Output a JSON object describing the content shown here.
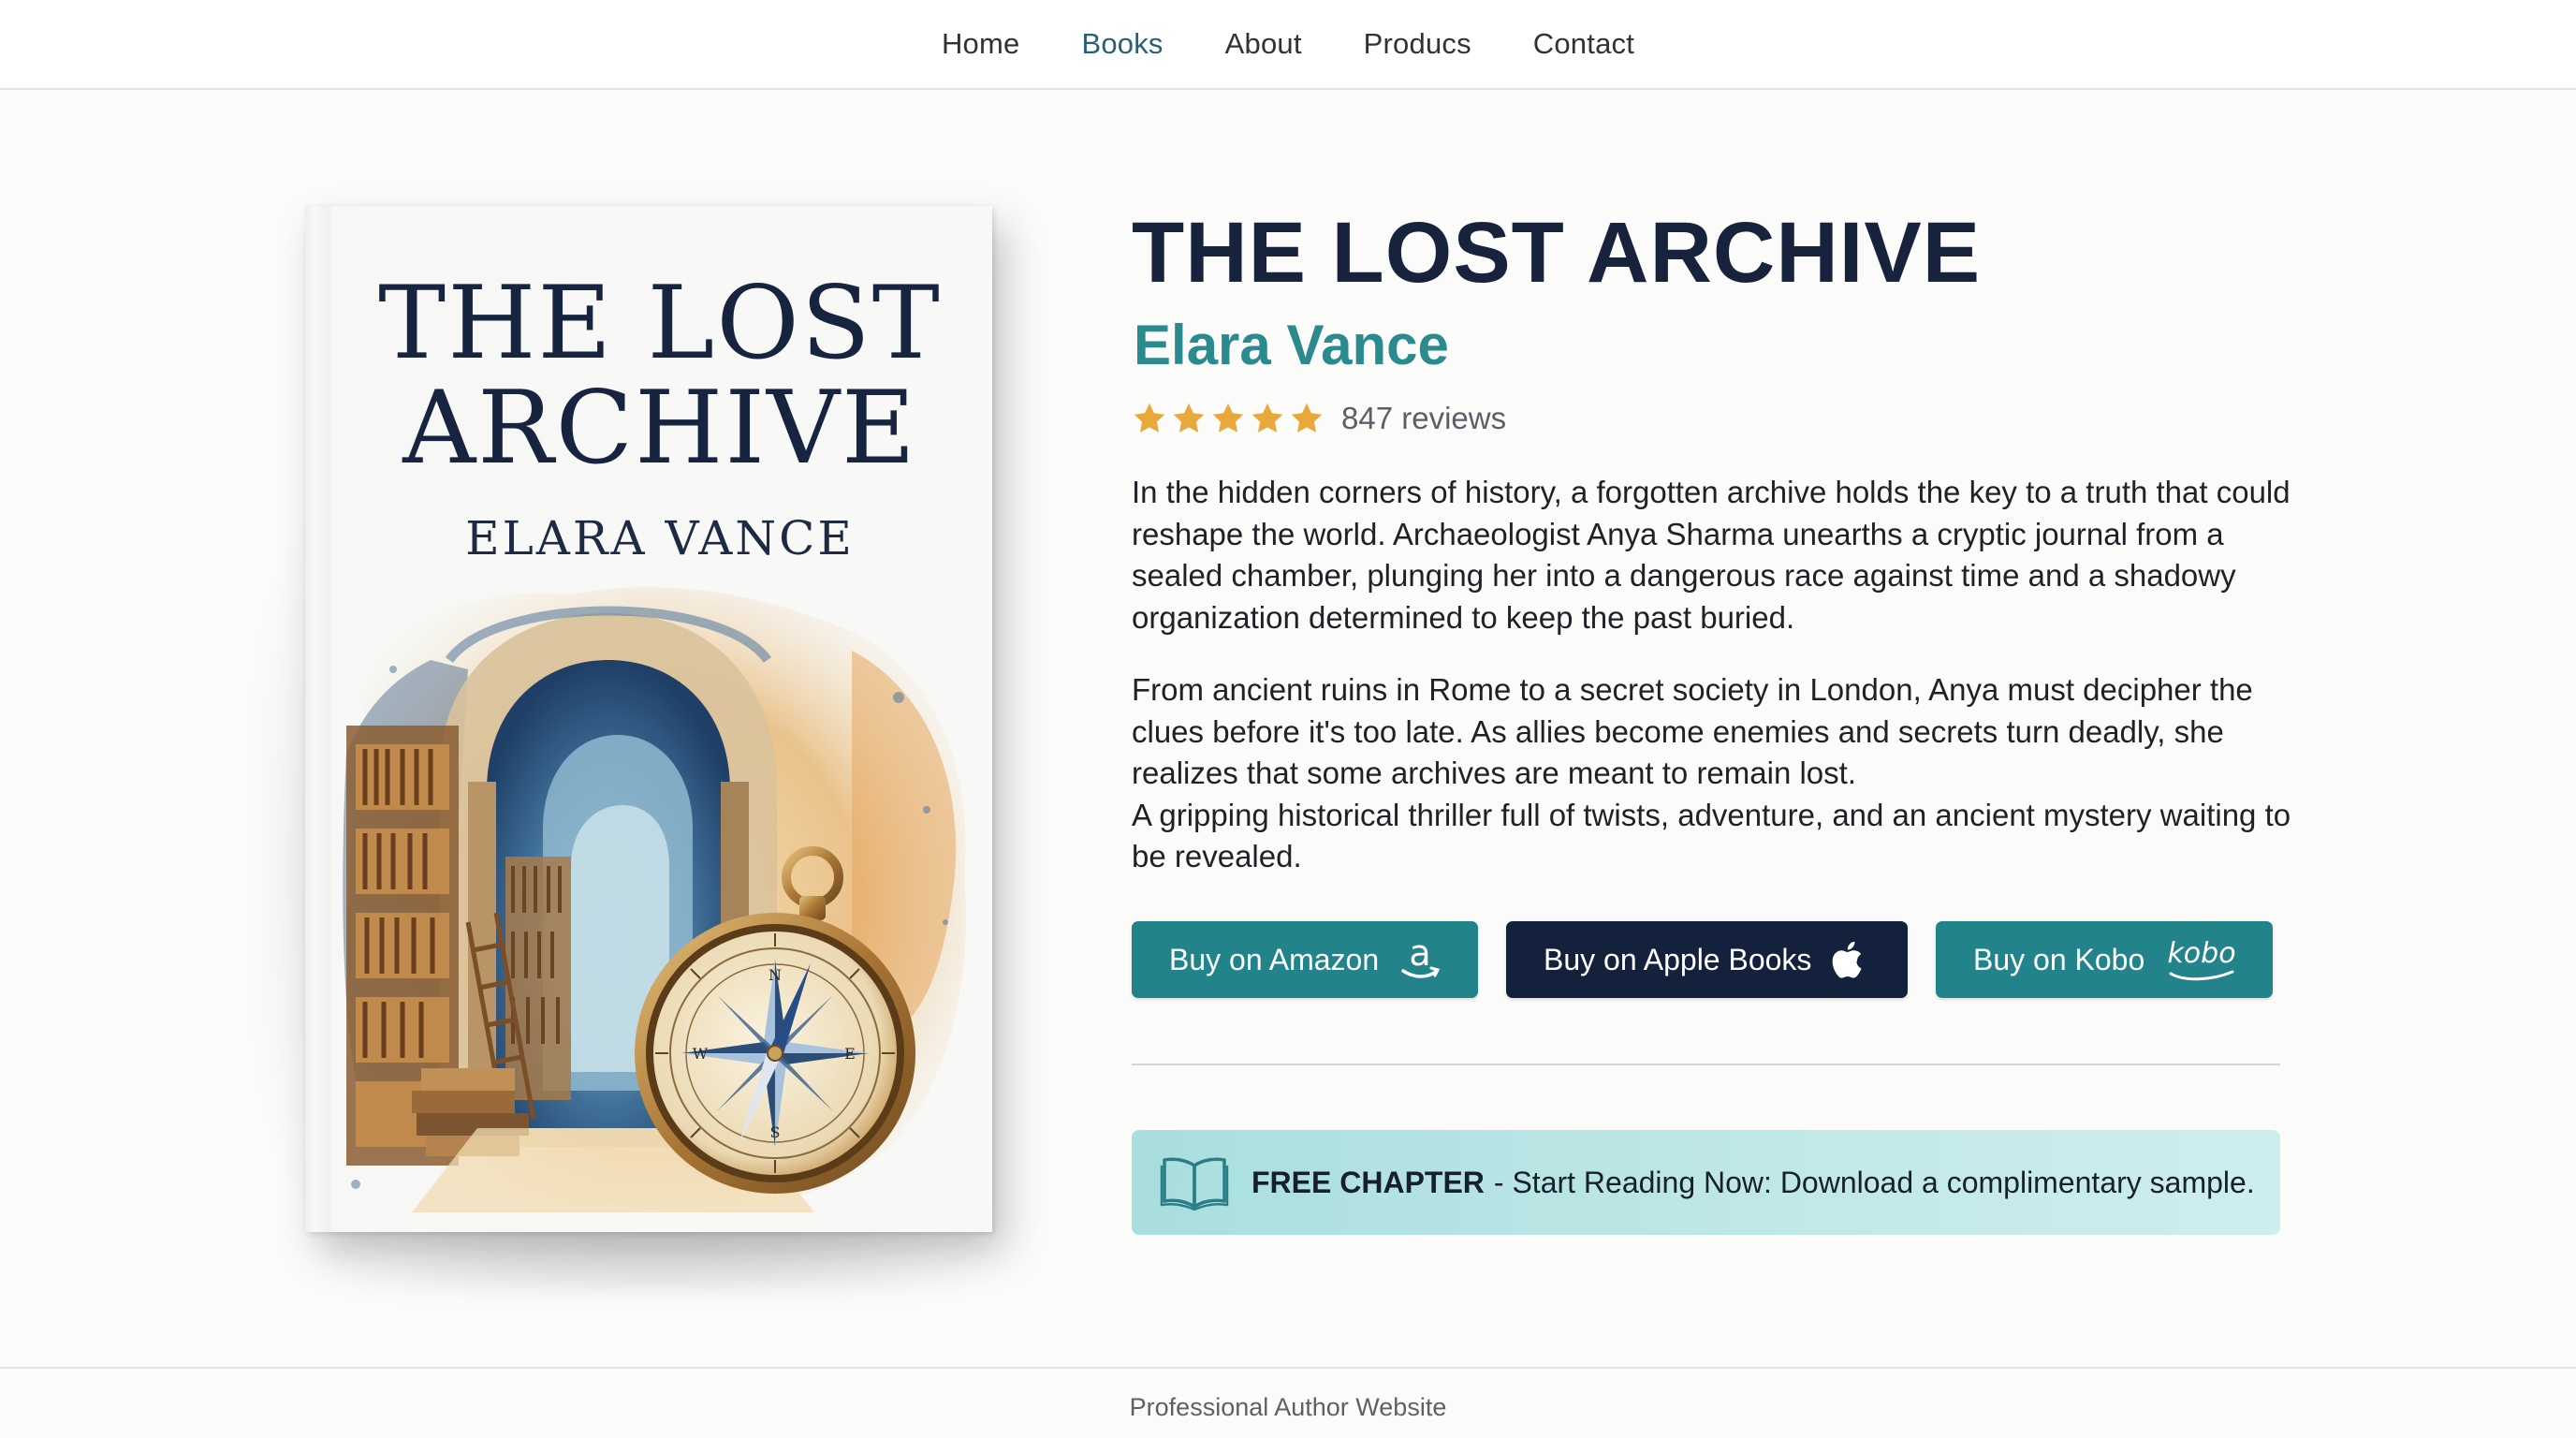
{
  "nav": {
    "items": [
      {
        "label": "Home",
        "active": false
      },
      {
        "label": "Books",
        "active": true
      },
      {
        "label": "About",
        "active": false
      },
      {
        "label": "Producs",
        "active": false
      },
      {
        "label": "Contact",
        "active": false
      }
    ]
  },
  "cover": {
    "title": "THE LOST\nARCHIVE",
    "author": "ELARA VANCE"
  },
  "book": {
    "title": "THE LOST ARCHIVE",
    "author": "Elara Vance",
    "rating": 5,
    "reviews": "847 reviews",
    "description": [
      "In the hidden corners of history, a forgotten archive holds the key to a truth that could reshape the world. Archaeologist Anya Sharma unearths a cryptic journal from a sealed chamber, plunging her into a dangerous race against time and a shadowy organization determined to keep the past buried.",
      "From ancient ruins in Rome to a secret society in London, Anya must decipher the clues before it's too late. As allies become enemies and secrets turn deadly, she realizes that some archives are meant to remain lost.",
      "A gripping historical thriller full of twists, adventure, and an ancient mystery waiting to be revealed."
    ]
  },
  "buttons": {
    "amazon": {
      "label": "Buy on Amazon",
      "icon": "amazon-icon"
    },
    "apple": {
      "label": "Buy on Apple Books",
      "icon": "apple-icon"
    },
    "kobo": {
      "label": "Buy on Kobo",
      "icon": "kobo-icon",
      "icon_text": "kobo"
    }
  },
  "free_chapter": {
    "bold": "FREE CHAPTER",
    "text": "- Start Reading Now: Download a complimentary sample.",
    "icon": "open-book-icon"
  },
  "footer": {
    "text": "Professional Author Website"
  },
  "colors": {
    "teal": "#22848a",
    "navy": "#13213d",
    "title": "#17223d",
    "author": "#2a8a8e",
    "star": "#e8a93a",
    "banner": "#c2e8e8"
  }
}
